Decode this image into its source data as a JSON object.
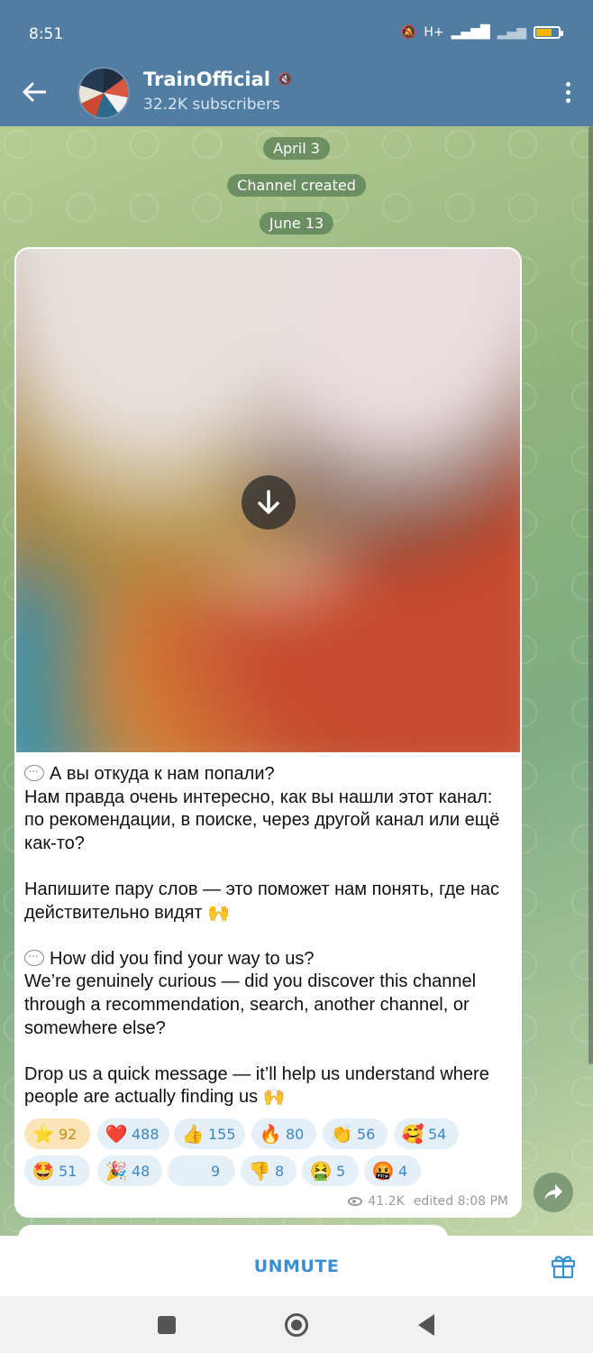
{
  "status_bar": {
    "time": "8:51",
    "network_label": "H+"
  },
  "header": {
    "title": "TrainOfficial",
    "subtitle": "32.2K subscribers"
  },
  "service_messages": {
    "date_1": "April 3",
    "channel_created": "Channel created",
    "date_2": "June 13"
  },
  "message": {
    "paragraphs": [
      "А вы откуда к нам попали?\nНам правда очень интересно, как вы нашли этот канал: по рекомендации, в поиске, через другой канал или ещё как-то?",
      "Напишите пару слов — это поможет нам понять, где нас действительно видят 🙌",
      "How did you find your way to us?\nWe’re genuinely curious — did you discover this channel through a recommendation, search, another channel, or somewhere else?",
      "Drop us a quick message — it’ll help us understand where people are actually finding us 🙌"
    ],
    "reactions": [
      {
        "emoji": "⭐",
        "count": "92",
        "chosen": true
      },
      {
        "emoji": "❤️",
        "count": "488"
      },
      {
        "emoji": "👍",
        "count": "155"
      },
      {
        "emoji": "🔥",
        "count": "80"
      },
      {
        "emoji": "👏",
        "count": "56"
      },
      {
        "emoji": "🥰",
        "count": "54"
      },
      {
        "emoji": "🤩",
        "count": "51"
      },
      {
        "emoji": "🎉",
        "count": "48"
      },
      {
        "emoji": "",
        "count": "9"
      },
      {
        "emoji": "👎",
        "count": "8"
      },
      {
        "emoji": "🤮",
        "count": "5"
      },
      {
        "emoji": "🤬",
        "count": "4"
      }
    ],
    "views": "41.2K",
    "edited_time": "edited 8:08 PM"
  },
  "bottom_bar": {
    "unmute_label": "UNMUTE"
  },
  "icons": [
    "back-arrow-icon",
    "mute-icon",
    "more-vertical-icon",
    "download-icon",
    "speech-bubble-icon",
    "eye-icon",
    "share-icon",
    "gift-icon"
  ],
  "colors": {
    "header": "#517da2",
    "accent": "#3a8fd0",
    "reaction_bg": "#e4eff8",
    "chosen_reaction_bg": "#fbe5b8"
  }
}
